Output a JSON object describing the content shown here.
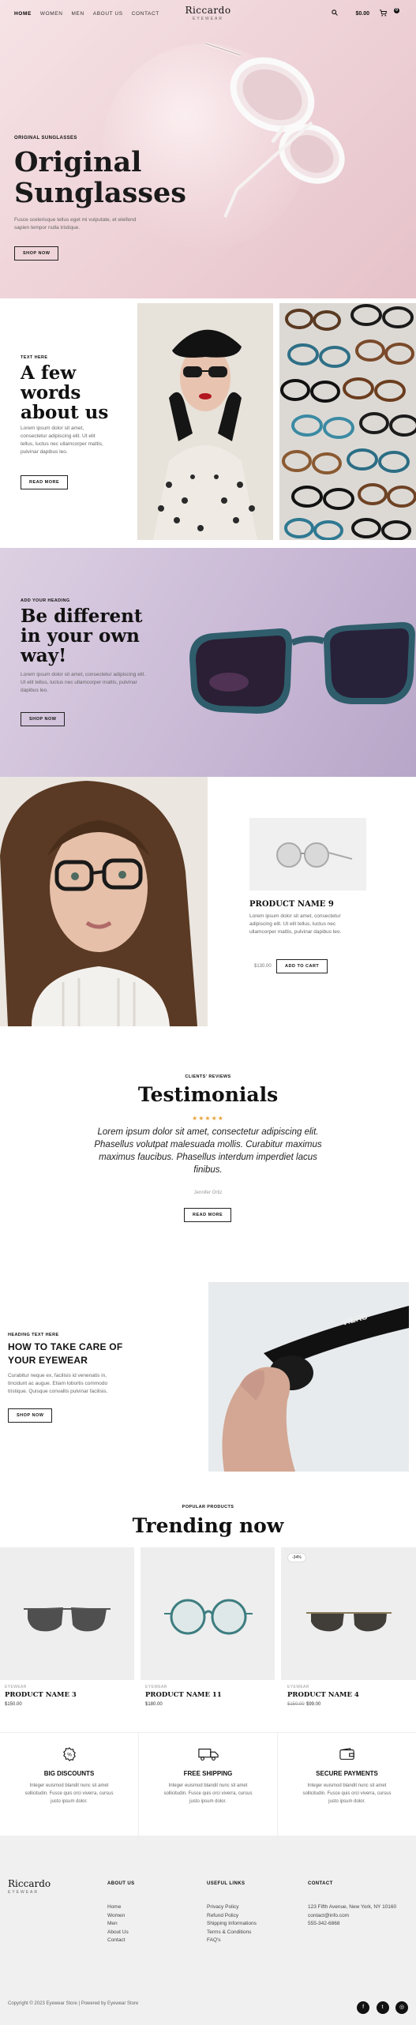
{
  "header": {
    "nav": [
      "HOME",
      "WOMEN",
      "MEN",
      "ABOUT US",
      "CONTACT"
    ],
    "logo_name": "Riccardo",
    "logo_sub": "EYEWEAR",
    "cart_total": "$0.00",
    "cart_count": "0",
    "icons": [
      "search-icon",
      "cart-icon"
    ]
  },
  "hero": {
    "kicker": "ORIGINAL SUNGLASSES",
    "title_line1": "Original",
    "title_line2": "Sunglasses",
    "desc": "Fusce scelerisque tellus eget mi vulputate, et eleifend sapien tempor nulla tristique.",
    "button": "SHOP NOW"
  },
  "words": {
    "kicker": "TEXT HERE",
    "title_line1": "A few",
    "title_line2": "words",
    "title_line3": "about us",
    "desc": "Lorem ipsum dolor sit amet, consectetur adipiscing elit. Ut elit tellus, luctus nec ullamcorper mattis, pulvinar dapibus leo.",
    "button": "READ MORE"
  },
  "different": {
    "kicker": "ADD YOUR HEADING",
    "title_line1": "Be different",
    "title_line2": "in your own",
    "title_line3": "way!",
    "desc": "Lorem ipsum dolor sit amet, consectetur adipiscing elit. Ut elit tellus, luctus nec ullamcorper mattis, pulvinar dapibus leo.",
    "button": "SHOP NOW"
  },
  "product": {
    "name": "PRODUCT NAME 9",
    "desc": "Lorem ipsum dolor sit amet, consectetur adipiscing elit. Ut elit tellus, luctus nec ullamcorper mattis, pulvinar dapibus leo.",
    "price": "$130.00",
    "button": "ADD TO CART"
  },
  "testimonials": {
    "kicker": "CLIENTS' REVIEWS",
    "title": "Testimonials",
    "stars": "★★★★★",
    "quote": "Lorem ipsum dolor sit amet, consectetur adipiscing elit. Phasellus volutpat malesuada mollis. Curabitur maximus maximus faucibus. Phasellus interdum imperdiet lacus finibus.",
    "author": "Jennifer Ortiz",
    "button": "READ MORE"
  },
  "care": {
    "kicker": "HEADING TEXT HERE",
    "title_line1": "HOW TO TAKE CARE OF",
    "title_line2": "YOUR EYEWEAR",
    "desc": "Curabitur neque ex, facilisis id venenatis in, tincidunt ac augue. Etiam lobortis commodo tristique. Quisque convallis pulvinar facilisis.",
    "button": "SHOP NOW",
    "frame_brand": "VIERS"
  },
  "trending": {
    "kicker": "POPULAR PRODUCTS",
    "title": "Trending now",
    "items": [
      {
        "category": "EYEWEAR",
        "name": "PRODUCT NAME 3",
        "price": "$150.00",
        "old_price": ""
      },
      {
        "category": "EYEWEAR",
        "name": "PRODUCT NAME 11",
        "price": "$180.00",
        "old_price": ""
      },
      {
        "category": "EYEWEAR",
        "name": "PRODUCT NAME 4",
        "price": "$99.00",
        "old_price": "$150.00",
        "badge": "-34%"
      }
    ]
  },
  "features": [
    {
      "icon": "gear-badge-icon",
      "title": "BIG DISCOUNTS",
      "desc": "Integer euismod blandit nunc sit amet sollicitudin. Fusce quis orci viverra, cursus justo ipsum dolor."
    },
    {
      "icon": "truck-icon",
      "title": "FREE SHIPPING",
      "desc": "Integer euismod blandit nunc sit amet sollicitudin. Fusce quis orci viverra, cursus justo ipsum dolor."
    },
    {
      "icon": "wallet-icon",
      "title": "SECURE PAYMENTS",
      "desc": "Integer euismod blandit nunc sit amet sollicitudin. Fusce quis orci viverra, cursus justo ipsum dolor."
    }
  ],
  "footer": {
    "logo_name": "Riccardo",
    "logo_sub": "EYEWEAR",
    "about_title": "ABOUT US",
    "about_links": [
      "Home",
      "Women",
      "Men",
      "About Us",
      "Contact"
    ],
    "useful_title": "USEFUL LINKS",
    "useful_links": [
      "Privacy Policy",
      "Refund Policy",
      "Shipping Informations",
      "Terms & Conditions",
      "FAQ's"
    ],
    "contact_title": "CONTACT",
    "contact_lines": [
      "123 Fifth Avenue, New York, NY 10160",
      "contact@info.com",
      "555-342-6868"
    ],
    "copyright": "Copyright © 2023 Eyewear Store | Powered by Eyewear Store",
    "social": [
      "f",
      "t",
      "◎"
    ]
  }
}
